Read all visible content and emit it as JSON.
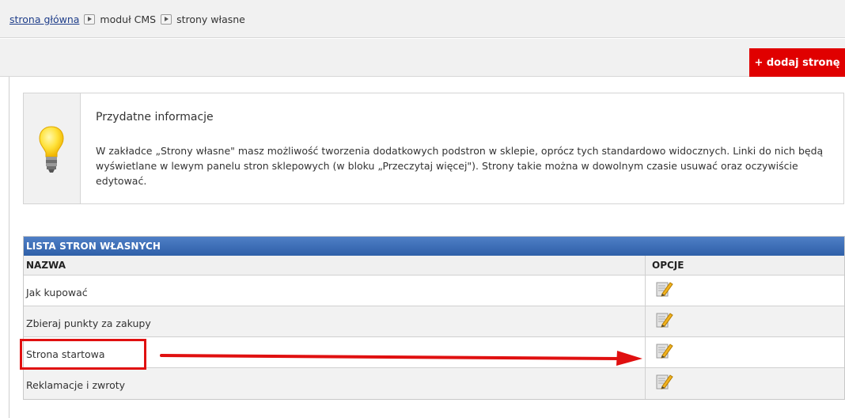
{
  "breadcrumb": {
    "home": "strona główna",
    "module": "moduł CMS",
    "current": "strony własne"
  },
  "toolbar": {
    "add_label": "+ dodaj stronę"
  },
  "info": {
    "icon": "lightbulb-icon",
    "title": "Przydatne informacje",
    "text": "W zakładce „Strony własne\" masz możliwość tworzenia dodatkowych podstron w sklepie, oprócz tych standardowo widocznych. Linki do nich będą wyświetlane w lewym panelu stron sklepowych (w bloku „Przeczytaj więcej\"). Strony takie można w dowolnym czasie usuwać oraz oczywiście edytować."
  },
  "list": {
    "title": "LISTA STRON WŁASNYCH",
    "columns": {
      "name": "NAZWA",
      "options": "OPCJE"
    },
    "rows": [
      {
        "name": "Jak kupować",
        "edit_icon": "edit-icon"
      },
      {
        "name": "Zbieraj punkty za zakupy",
        "edit_icon": "edit-icon"
      },
      {
        "name": "Strona startowa",
        "edit_icon": "edit-icon"
      },
      {
        "name": "Reklamacje i zwroty",
        "edit_icon": "edit-icon"
      }
    ]
  },
  "colors": {
    "accent": "#e00000",
    "header_blue": "#3a6bb5",
    "annotation": "#e01010"
  }
}
